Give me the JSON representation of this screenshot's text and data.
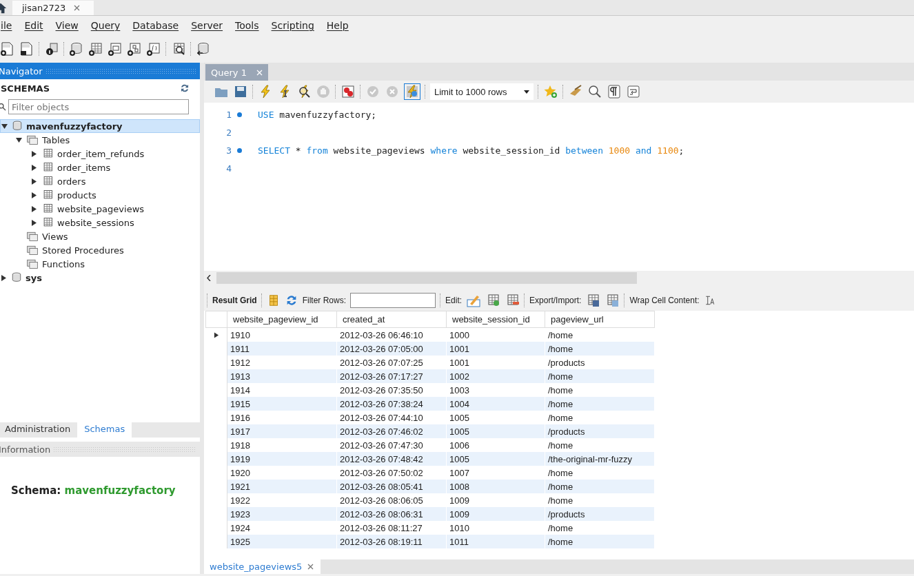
{
  "top_tabs": [
    {
      "label": "jisan2723",
      "selected": true
    }
  ],
  "menu": [
    "ile",
    "Edit",
    "View",
    "Query",
    "Database",
    "Server",
    "Tools",
    "Scripting",
    "Help"
  ],
  "navigator": {
    "title": "Navigator",
    "schemas_label": "SCHEMAS",
    "filter_placeholder": "Filter objects",
    "tree": [
      {
        "label": "mavenfuzzyfactory",
        "kind": "schema",
        "expanded": true,
        "selected": true,
        "children": [
          {
            "label": "Tables",
            "kind": "folder",
            "expanded": true,
            "selected": false,
            "children": [
              {
                "label": "order_item_refunds",
                "kind": "table",
                "expanded": false,
                "selected": false
              },
              {
                "label": "order_items",
                "kind": "table",
                "expanded": false,
                "selected": false
              },
              {
                "label": "orders",
                "kind": "table",
                "expanded": false,
                "selected": false
              },
              {
                "label": "products",
                "kind": "table",
                "expanded": false,
                "selected": false
              },
              {
                "label": "website_pageviews",
                "kind": "table",
                "expanded": false,
                "selected": false
              },
              {
                "label": "website_sessions",
                "kind": "table",
                "expanded": false,
                "selected": false
              }
            ]
          },
          {
            "label": "Views",
            "kind": "folder",
            "selected": false
          },
          {
            "label": "Stored Procedures",
            "kind": "folder",
            "selected": false
          },
          {
            "label": "Functions",
            "kind": "folder",
            "selected": false
          }
        ]
      },
      {
        "label": "sys",
        "kind": "schema",
        "expanded": false,
        "selected": false
      }
    ],
    "bottom_tabs": [
      {
        "label": "Administration",
        "selected": false
      },
      {
        "label": "Schemas",
        "selected": true
      }
    ],
    "info_title": "Information",
    "info_label": "Schema:",
    "info_value": "mavenfuzzyfactory"
  },
  "query_tabs": [
    {
      "label": "Query 1",
      "selected": true
    }
  ],
  "limit_select": "Limit to 1000 rows",
  "editor": [
    {
      "number": "1",
      "marker": true,
      "tokens": [
        {
          "text": "USE",
          "kind": "keyword"
        },
        {
          "text": " mavenfuzzyfactory;",
          "kind": "plain"
        }
      ]
    },
    {
      "number": "2",
      "marker": false
    },
    {
      "number": "3",
      "marker": true,
      "tokens": [
        {
          "text": "SELECT",
          "kind": "keyword"
        },
        {
          "text": " * ",
          "kind": "plain"
        },
        {
          "text": "from",
          "kind": "keyword"
        },
        {
          "text": " website_pageviews ",
          "kind": "plain"
        },
        {
          "text": "where",
          "kind": "keyword"
        },
        {
          "text": " website_session_id ",
          "kind": "plain"
        },
        {
          "text": "between ",
          "kind": "keyword"
        },
        {
          "text": "1000",
          "kind": "number"
        },
        {
          "text": " and ",
          "kind": "keyword"
        },
        {
          "text": "1100",
          "kind": "number"
        },
        {
          "text": ";",
          "kind": "plain"
        }
      ]
    },
    {
      "number": "4",
      "marker": false
    }
  ],
  "result_toolbar": {
    "result_grid": "Result Grid",
    "filter_label": "Filter Rows:",
    "edit_label": "Edit:",
    "export_label": "Export/Import:",
    "wrap_label": "Wrap Cell Content:"
  },
  "table": {
    "columns": [
      "website_pageview_id",
      "created_at",
      "website_session_id",
      "pageview_url"
    ],
    "rows": [
      {
        "selected": true,
        "cells": [
          "1910",
          "2012-03-26 06:46:10",
          "1000",
          "/home"
        ]
      },
      {
        "selected": false,
        "cells": [
          "1911",
          "2012-03-26 07:05:00",
          "1001",
          "/home"
        ]
      },
      {
        "selected": false,
        "cells": [
          "1912",
          "2012-03-26 07:07:25",
          "1001",
          "/products"
        ]
      },
      {
        "selected": false,
        "cells": [
          "1913",
          "2012-03-26 07:17:27",
          "1002",
          "/home"
        ]
      },
      {
        "selected": false,
        "cells": [
          "1914",
          "2012-03-26 07:35:50",
          "1003",
          "/home"
        ]
      },
      {
        "selected": false,
        "cells": [
          "1915",
          "2012-03-26 07:38:24",
          "1004",
          "/home"
        ]
      },
      {
        "selected": false,
        "cells": [
          "1916",
          "2012-03-26 07:44:10",
          "1005",
          "/home"
        ]
      },
      {
        "selected": false,
        "cells": [
          "1917",
          "2012-03-26 07:46:02",
          "1005",
          "/products"
        ]
      },
      {
        "selected": false,
        "cells": [
          "1918",
          "2012-03-26 07:47:30",
          "1006",
          "/home"
        ]
      },
      {
        "selected": false,
        "cells": [
          "1919",
          "2012-03-26 07:48:42",
          "1005",
          "/the-original-mr-fuzzy"
        ]
      },
      {
        "selected": false,
        "cells": [
          "1920",
          "2012-03-26 07:50:02",
          "1007",
          "/home"
        ]
      },
      {
        "selected": false,
        "cells": [
          "1921",
          "2012-03-26 08:05:41",
          "1008",
          "/home"
        ]
      },
      {
        "selected": false,
        "cells": [
          "1922",
          "2012-03-26 08:06:05",
          "1009",
          "/home"
        ]
      },
      {
        "selected": false,
        "cells": [
          "1923",
          "2012-03-26 08:06:31",
          "1009",
          "/products"
        ]
      },
      {
        "selected": false,
        "cells": [
          "1924",
          "2012-03-26 08:11:27",
          "1010",
          "/home"
        ]
      },
      {
        "selected": false,
        "cells": [
          "1925",
          "2012-03-26 08:19:11",
          "1011",
          "/home"
        ]
      }
    ]
  },
  "result_tabs": [
    {
      "label": "website_pageviews5",
      "selected": true
    }
  ]
}
